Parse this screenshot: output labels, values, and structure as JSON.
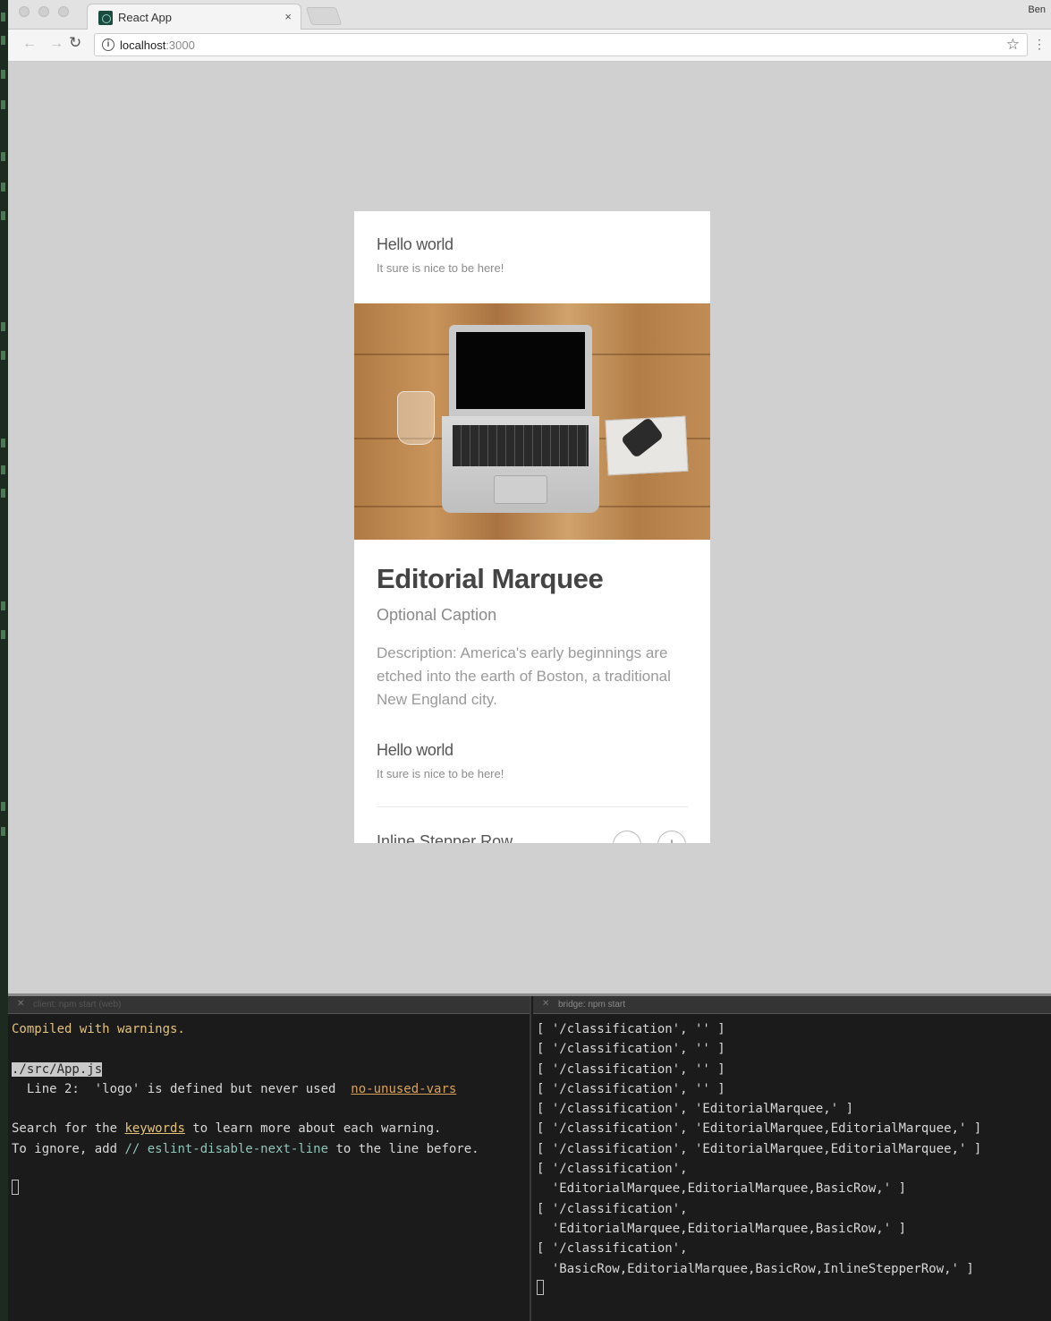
{
  "browser": {
    "tab_title": "React App",
    "tab_close": "×",
    "profile": "Ben",
    "url_host": "localhost",
    "url_port": ":3000"
  },
  "card": {
    "basic_row_1": {
      "title": "Hello world",
      "subtitle": "It sure is nice to be here!"
    },
    "editorial_marquee": {
      "title": "Editorial Marquee",
      "caption": "Optional Caption",
      "description": "Description: America's early beginnings are etched into the earth of Boston, a traditional New England city."
    },
    "basic_row_2": {
      "title": "Hello world",
      "subtitle": "It sure is nice to be here!"
    },
    "stepper": {
      "label": "Inline Stepper Row",
      "minus": "−",
      "plus": "+"
    }
  },
  "terminal_left": {
    "title": "client: npm start (web)",
    "compiled": "Compiled with warnings.",
    "file": "./src/App.js",
    "line_prefix": "  Line 2:  ",
    "line_message": "'logo' is defined but never used  ",
    "rule": "no-unused-vars",
    "search_before": "Search for the ",
    "search_keyword": "keywords",
    "search_after": " to learn more about each warning.",
    "ignore_before": "To ignore, add ",
    "ignore_cmd": "// eslint-disable-next-line",
    "ignore_after": " to the line before."
  },
  "terminal_right": {
    "title": "bridge: npm start",
    "lines": [
      "[ '/classification', '' ]",
      "[ '/classification', '' ]",
      "[ '/classification', '' ]",
      "[ '/classification', '' ]",
      "[ '/classification', 'EditorialMarquee,' ]",
      "[ '/classification', 'EditorialMarquee,EditorialMarquee,' ]",
      "[ '/classification', 'EditorialMarquee,EditorialMarquee,' ]",
      "[ '/classification',",
      "  'EditorialMarquee,EditorialMarquee,BasicRow,' ]",
      "[ '/classification',",
      "  'EditorialMarquee,EditorialMarquee,BasicRow,' ]",
      "[ '/classification',",
      "  'BasicRow,EditorialMarquee,BasicRow,InlineStepperRow,' ]"
    ]
  }
}
